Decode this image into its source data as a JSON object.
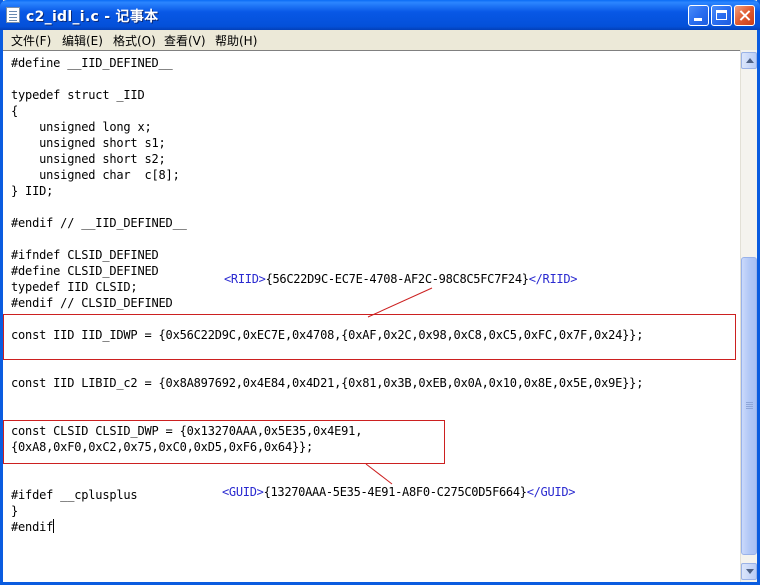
{
  "window": {
    "title": "c2_idl_i.c - 记事本"
  },
  "menu": {
    "items": [
      {
        "label": "文件(F)"
      },
      {
        "label": "编辑(E)"
      },
      {
        "label": "格式(O)"
      },
      {
        "label": "查看(V)"
      },
      {
        "label": "帮助(H)"
      }
    ]
  },
  "editor": {
    "lines": [
      "#define __IID_DEFINED__",
      "",
      "typedef struct _IID",
      "{",
      "    unsigned long x;",
      "    unsigned short s1;",
      "    unsigned short s2;",
      "    unsigned char  c[8];",
      "} IID;",
      "",
      "#endif // __IID_DEFINED__",
      "",
      "#ifndef CLSID_DEFINED",
      "#define CLSID_DEFINED",
      "typedef IID CLSID;",
      "#endif // CLSID_DEFINED",
      "",
      "const IID IID_IDWP = {0x56C22D9C,0xEC7E,0x4708,{0xAF,0x2C,0x98,0xC8,0xC5,0xFC,0x7F,0x24}};",
      "",
      "",
      "const IID LIBID_c2 = {0x8A897692,0x4E84,0x4D21,{0x81,0x3B,0xEB,0x0A,0x10,0x8E,0x5E,0x9E}};",
      "",
      "",
      "const CLSID CLSID_DWP = {0x13270AAA,0x5E35,0x4E91,",
      "{0xA8,0xF0,0xC2,0x75,0xC0,0xD5,0xF6,0x64}};",
      "",
      "",
      "#ifdef __cplusplus",
      "}",
      "#endif"
    ]
  },
  "annotations": {
    "riid": {
      "open_tag": "<RIID>",
      "value": "{56C22D9C-EC7E-4708-AF2C-98C8C5FC7F24}",
      "close_tag": "</RIID>"
    },
    "guid": {
      "open_tag": "<GUID>",
      "value": "{13270AAA-5E35-4E91-A8F0-C275C0D5F664}",
      "close_tag": "</GUID>"
    },
    "color": "#cc2020",
    "tag_color": "#2a2ad0"
  }
}
